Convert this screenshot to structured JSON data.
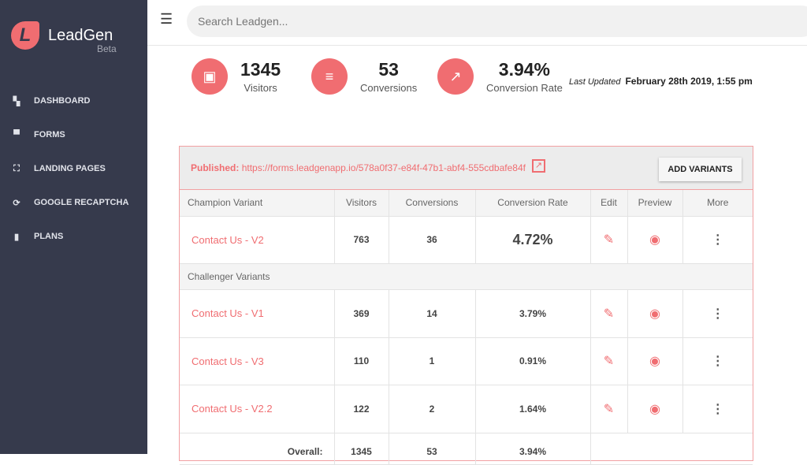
{
  "app": {
    "brand": "LeadGen",
    "badge": "Beta",
    "logo_letter": "L",
    "accent": "#f06d71"
  },
  "sidebar": {
    "items": [
      {
        "label": "DASHBOARD",
        "icon": "dashboard-icon",
        "glyph": "▚"
      },
      {
        "label": "FORMS",
        "icon": "forum-icon",
        "glyph": "▀"
      },
      {
        "label": "LANDING PAGES",
        "icon": "fullscreen-icon",
        "glyph": "⛶"
      },
      {
        "label": "GOOGLE RECAPTCHA",
        "icon": "sync-icon",
        "glyph": "⟳"
      },
      {
        "label": "PLANS",
        "icon": "battery-icon",
        "glyph": "▮"
      }
    ]
  },
  "search": {
    "placeholder": "Search Leadgen..."
  },
  "stats": [
    {
      "value": "1345",
      "label": "Visitors",
      "icon": "contact-icon",
      "glyph": "▣"
    },
    {
      "value": "53",
      "label": "Conversions",
      "icon": "list-icon",
      "glyph": "≡"
    },
    {
      "value": "3.94%",
      "label": "Conversion Rate",
      "icon": "trending-up-icon",
      "glyph": "↗"
    }
  ],
  "last_updated": {
    "label": "Last Updated",
    "value": "February 28th 2019, 1:55 pm"
  },
  "card": {
    "published_label": "Published:",
    "url": "https://forms.leadgenapp.io/578a0f37-e84f-47b1-abf4-555cdbafe84f",
    "add_button": "ADD VARIANTS",
    "columns": [
      "Champion Variant",
      "Visitors",
      "Conversions",
      "Conversion Rate",
      "Edit",
      "Preview",
      "More"
    ],
    "champion": {
      "name": "Contact Us - V2",
      "visitors": "763",
      "conversions": "36",
      "rate": "4.72%"
    },
    "challenger_label": "Challenger Variants",
    "challengers": [
      {
        "name": "Contact Us - V1",
        "visitors": "369",
        "conversions": "14",
        "rate": "3.79%"
      },
      {
        "name": "Contact Us - V3",
        "visitors": "110",
        "conversions": "1",
        "rate": "0.91%"
      },
      {
        "name": "Contact Us - V2.2",
        "visitors": "122",
        "conversions": "2",
        "rate": "1.64%"
      }
    ],
    "overall": {
      "label": "Overall:",
      "visitors": "1345",
      "conversions": "53",
      "rate": "3.94%"
    }
  }
}
